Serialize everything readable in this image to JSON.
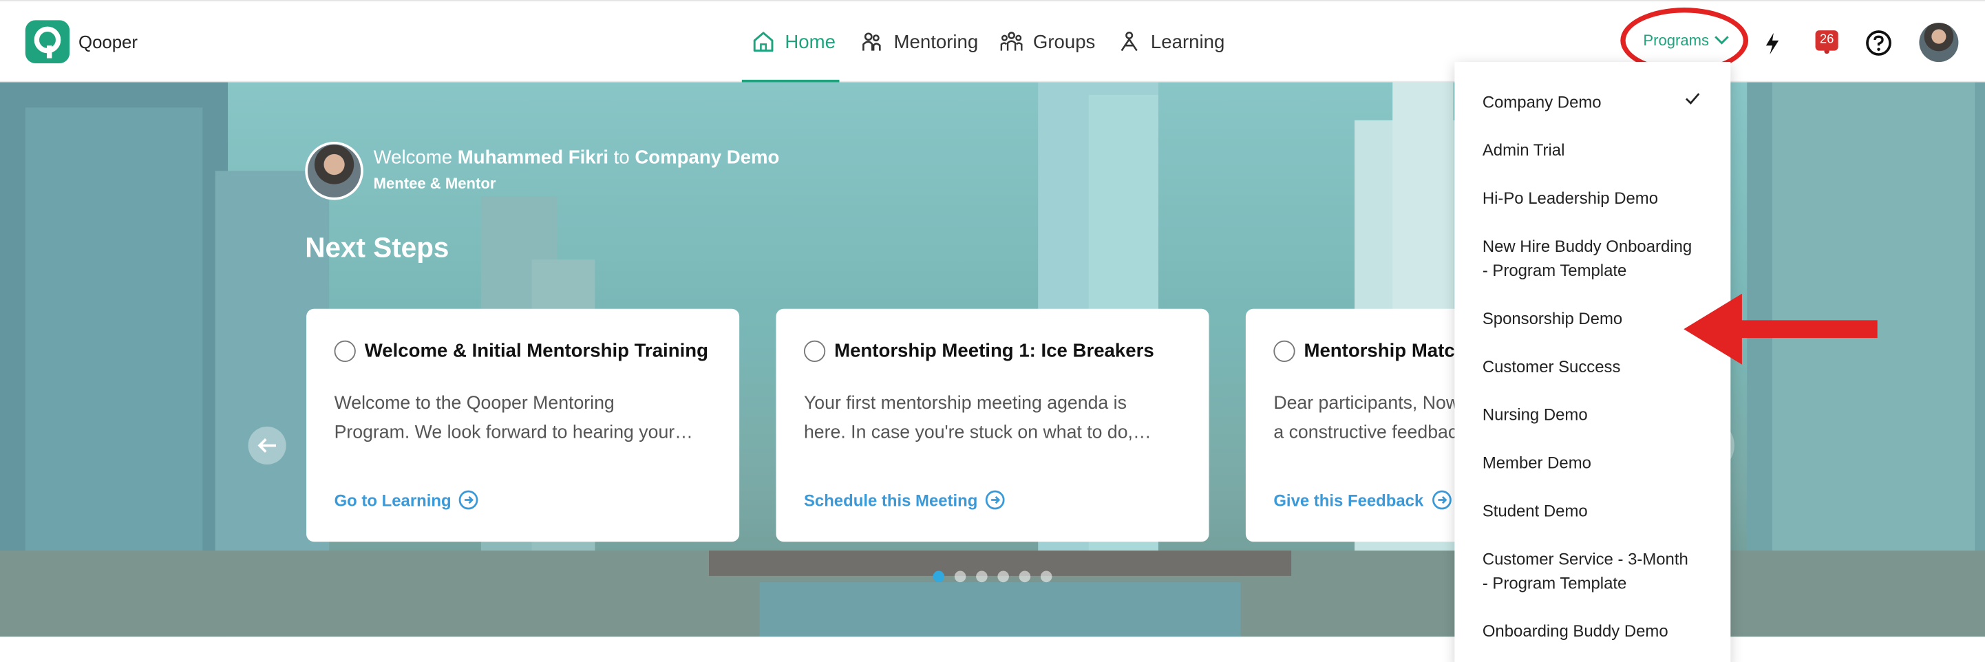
{
  "brand": {
    "name": "Qooper",
    "color": "#1fa37f"
  },
  "nav": [
    {
      "label": "Home",
      "icon": "home-icon",
      "active": true
    },
    {
      "label": "Mentoring",
      "icon": "mentoring-icon"
    },
    {
      "label": "Groups",
      "icon": "groups-icon"
    },
    {
      "label": "Learning",
      "icon": "learning-icon"
    }
  ],
  "header_right": {
    "programs_label": "Programs",
    "notifications_count": "26",
    "icons": [
      "lightning-icon",
      "bell-icon",
      "help-icon",
      "avatar"
    ]
  },
  "welcome": {
    "prefix": "Welcome",
    "user_name": "Muhammed Fikri",
    "middle": "to",
    "company": "Company Demo",
    "role": "Mentee & Mentor"
  },
  "next_steps": {
    "heading": "Next Steps",
    "cards": [
      {
        "title": "Welcome & Initial Mentorship Training",
        "desc_line1": "Welcome to the Qooper Mentoring",
        "desc_line2": "Program. We look forward to hearing your…",
        "link": "Go to Learning"
      },
      {
        "title": "Mentorship Meeting 1: Ice Breakers",
        "desc_line1": "Your first mentorship meeting agenda is",
        "desc_line2": "here. In case you're stuck on what to do,…",
        "link": "Schedule this Meeting"
      },
      {
        "title": "Mentorship Match",
        "desc_line1": "Dear participants, Now",
        "desc_line2": "a constructive feedback",
        "link": "Give this Feedback"
      }
    ],
    "carousel_dots": 6,
    "active_dot": 0
  },
  "programs_dropdown": {
    "selected": "Company Demo",
    "items": [
      {
        "line1": "Company Demo",
        "line2": ""
      },
      {
        "line1": "Admin Trial",
        "line2": ""
      },
      {
        "line1": "Hi-Po Leadership Demo",
        "line2": ""
      },
      {
        "line1": "New Hire Buddy Onboarding",
        "line2": "- Program Template"
      },
      {
        "line1": "Sponsorship Demo",
        "line2": ""
      },
      {
        "line1": "Customer Success",
        "line2": ""
      },
      {
        "line1": "Nursing Demo",
        "line2": ""
      },
      {
        "line1": "Member Demo",
        "line2": ""
      },
      {
        "line1": "Student Demo",
        "line2": ""
      },
      {
        "line1": "Customer Service - 3-Month",
        "line2": "- Program Template"
      },
      {
        "line1": "Onboarding Buddy Demo",
        "line2": ""
      }
    ]
  },
  "annotations": {
    "highlight_color": "#e32222"
  }
}
